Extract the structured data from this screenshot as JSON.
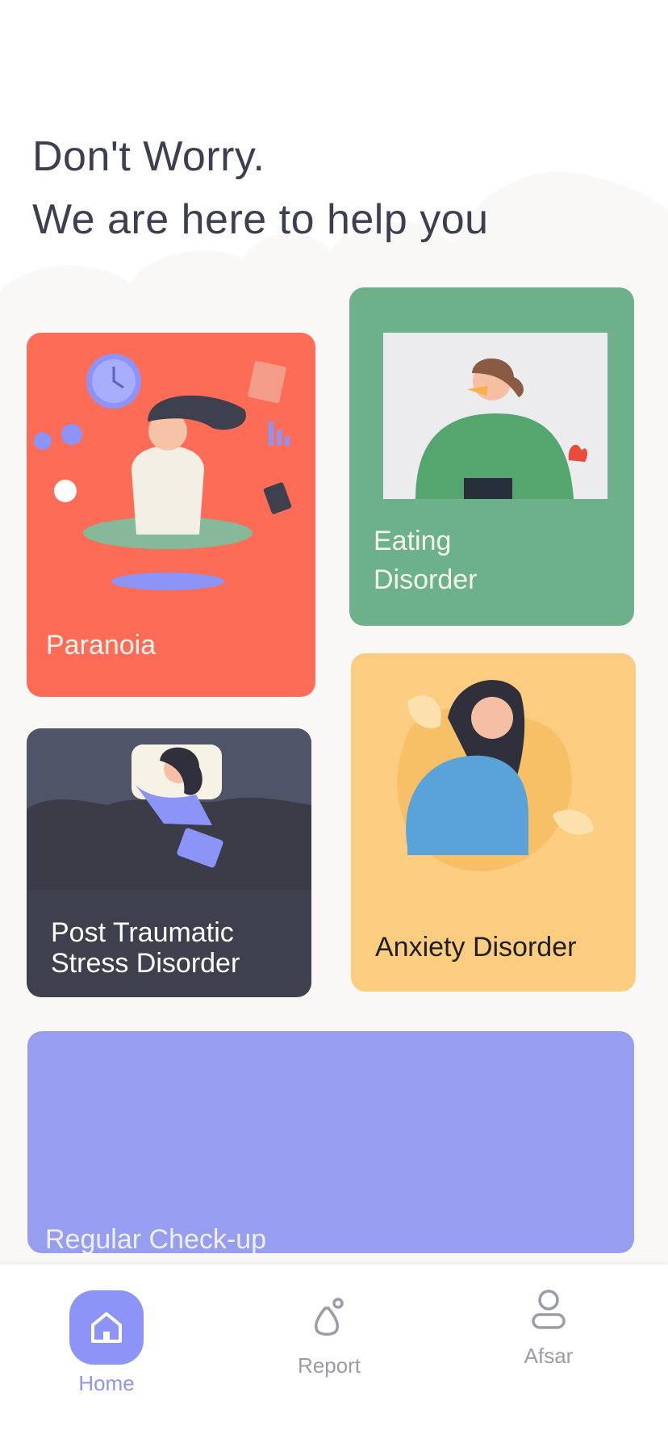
{
  "header": {
    "line1": "Don't Worry.",
    "line2": "We are here to help you"
  },
  "cards": {
    "paranoia": {
      "label": "Paranoia",
      "color": "#fc6c57"
    },
    "eating": {
      "label_line1": "Eating",
      "label_line2": "Disorder",
      "color": "#6db18a"
    },
    "ptsd": {
      "label_line1": "Post Traumatic",
      "label_line2": "Stress Disorder",
      "color": "#3f404d"
    },
    "anxiety": {
      "label": "Anxiety Disorder",
      "color": "#fccc80"
    },
    "checkup": {
      "label": "Regular Check-up",
      "color": "#979ef0"
    }
  },
  "nav": {
    "items": [
      {
        "label": "Home",
        "icon": "home-icon",
        "active": true
      },
      {
        "label": "Report",
        "icon": "report-icon",
        "active": false
      },
      {
        "label": "Afsar",
        "icon": "user-icon",
        "active": false
      }
    ],
    "active_color": "#8c94f7",
    "inactive_color": "#9a9ca8"
  }
}
